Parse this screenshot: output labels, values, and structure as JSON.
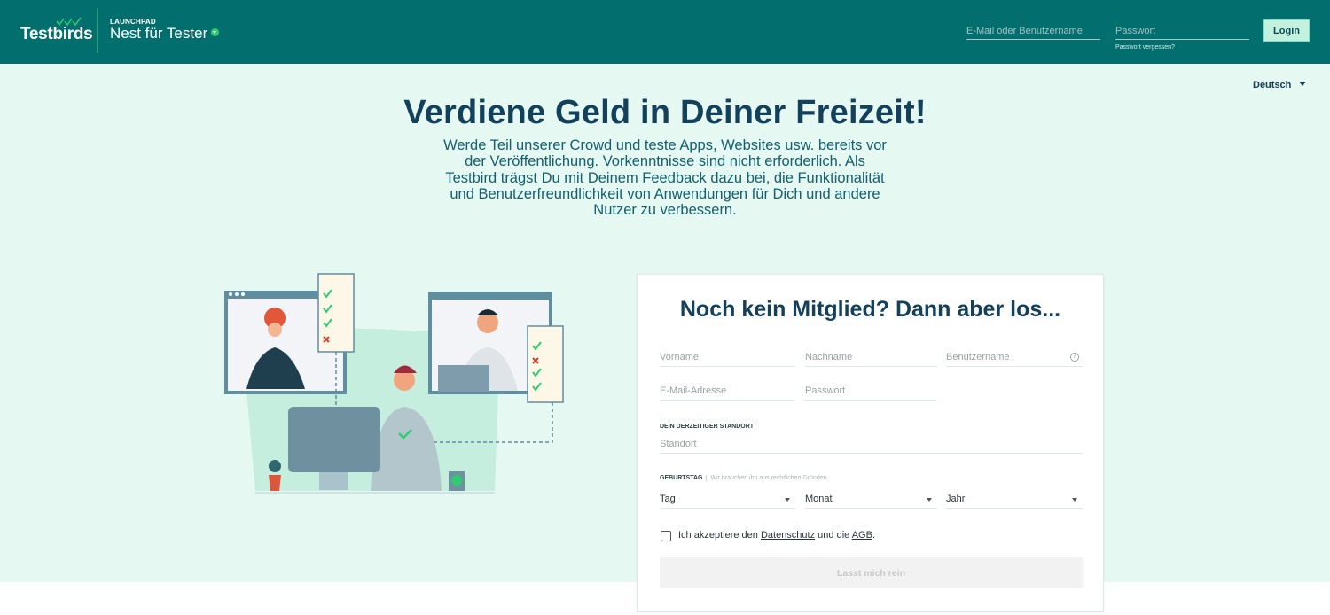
{
  "header": {
    "brand": "Testbirds",
    "launchpad": "LAUNCHPAD",
    "product": "Nest für Tester",
    "login_email_placeholder": "E-Mail oder Benutzername",
    "login_password_placeholder": "Passwort",
    "forgot_password": "Passwort vergessen?",
    "login_button": "Login"
  },
  "language": {
    "selected": "Deutsch"
  },
  "hero": {
    "title": "Verdiene Geld in Deiner Freizeit!",
    "subtitle": "Werde Teil unserer Crowd und teste Apps, Websites usw. bereits vor der Veröffentlichung. Vorkenntnisse sind nicht erforderlich. Als Testbird trägst Du mit Deinem Feedback dazu bei, die Funktionalität und Benutzerfreundlichkeit von Anwendungen für Dich und andere Nutzer zu verbessern."
  },
  "signup": {
    "title": "Noch kein Mitglied? Dann aber los...",
    "first_name": "Vorname",
    "last_name": "Nachname",
    "username": "Benutzername",
    "email": "E-Mail-Adresse",
    "password": "Passwort",
    "location_label": "DEIN DERZEITIGER STANDORT",
    "location_placeholder": "Standort",
    "birthday_label": "GEBURTSTAG",
    "birthday_hint": "Wir brauchen ihn aus rechtlichen Gründen",
    "day": "Tag",
    "month": "Monat",
    "year": "Jahr",
    "accept_prefix": "Ich akzeptiere den ",
    "privacy_link": "Datenschutz",
    "accept_middle": " und die ",
    "terms_link": "AGB",
    "accept_suffix": ".",
    "submit": "Lasst mich rein"
  },
  "colors": {
    "header_bg": "#036e6e",
    "hero_bg": "#e6f8f2",
    "accent_green": "#2ecc71",
    "login_bg": "#c3f1df"
  }
}
